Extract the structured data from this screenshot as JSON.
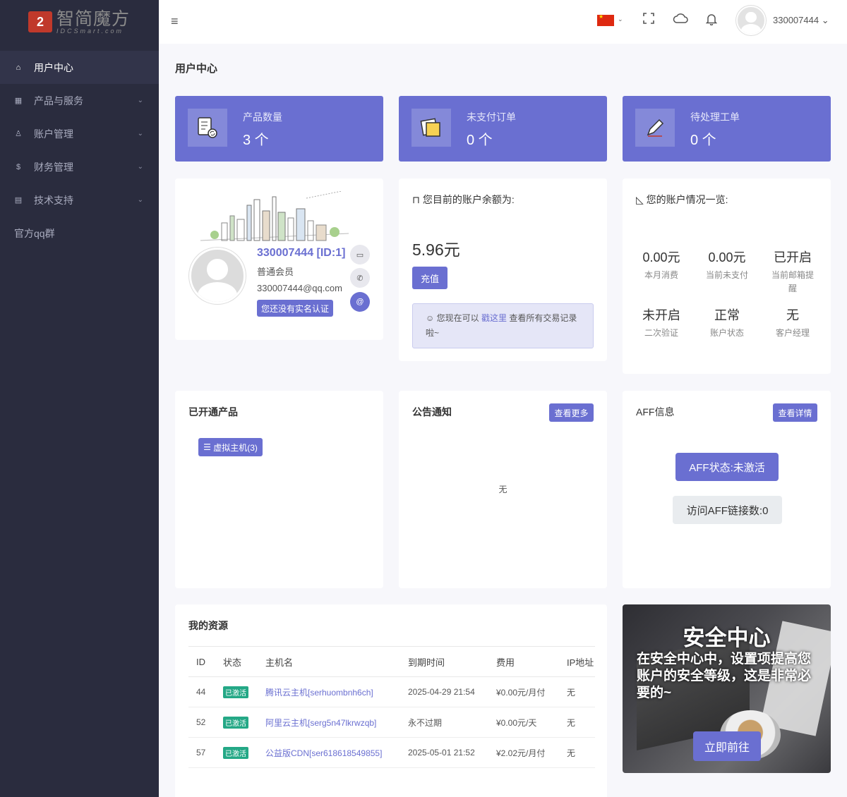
{
  "logo": {
    "cn": "智简魔方",
    "en": "IDCSmart.com"
  },
  "sidebar": {
    "items": [
      {
        "label": "用户中心",
        "icon": "home-icon"
      },
      {
        "label": "产品与服务",
        "icon": "grid-icon"
      },
      {
        "label": "账户管理",
        "icon": "user-icon"
      },
      {
        "label": "财务管理",
        "icon": "dollar-icon"
      },
      {
        "label": "技术支持",
        "icon": "support-icon"
      }
    ],
    "qq_group": "官方qq群"
  },
  "header": {
    "username": "330007444"
  },
  "page_title": "用户中心",
  "stats": [
    {
      "label": "产品数量",
      "value": "3 个"
    },
    {
      "label": "未支付订单",
      "value": "0 个"
    },
    {
      "label": "待处理工单",
      "value": "0 个"
    }
  ],
  "profile": {
    "name": "330007444 [ID:1]",
    "level": "普通会员",
    "email": "330007444@qq.com",
    "verify_button": "您还没有实名认证"
  },
  "balance": {
    "title": "您目前的账户余额为:",
    "value": "5.96元",
    "recharge_button": "充值",
    "note_prefix": "您现在可以",
    "note_link": "戳这里",
    "note_suffix": "查看所有交易记录啦~"
  },
  "overview": {
    "title": "您的账户情况一览:",
    "items": [
      {
        "value": "0.00元",
        "label": "本月消费"
      },
      {
        "value": "0.00元",
        "label": "当前未支付"
      },
      {
        "value": "已开启",
        "label": "当前邮箱提醒"
      },
      {
        "value": "未开启",
        "label": "二次验证"
      },
      {
        "value": "正常",
        "label": "账户状态"
      },
      {
        "value": "无",
        "label": "客户经理"
      }
    ]
  },
  "products": {
    "title": "已开通产品",
    "vhost_button": "虚拟主机(3)"
  },
  "notice": {
    "title": "公告通知",
    "more_button": "查看更多",
    "empty": "无"
  },
  "aff": {
    "title": "AFF信息",
    "detail_button": "查看详情",
    "state": "AFF状态:未激活",
    "visits": "访问AFF链接数:0"
  },
  "resources": {
    "title": "我的资源",
    "columns": [
      "ID",
      "状态",
      "主机名",
      "到期时间",
      "费用",
      "IP地址"
    ],
    "rows": [
      {
        "id": "44",
        "status": "已激活",
        "host": "腾讯云主机[serhuombnh6ch]",
        "expire": "2025-04-29 21:54",
        "fee": "¥0.00元/月付",
        "ip": "无"
      },
      {
        "id": "52",
        "status": "已激活",
        "host": "阿里云主机[serg5n47lkrwzqb]",
        "expire": "永不过期",
        "fee": "¥0.00元/天",
        "ip": "无"
      },
      {
        "id": "57",
        "status": "已激活",
        "host": "公益版CDN[ser618618549855]",
        "expire": "2025-05-01 21:52",
        "fee": "¥2.02元/月付",
        "ip": "无"
      }
    ]
  },
  "security": {
    "title": "安全中心",
    "desc": "在安全中心中，设置项提高您账户的安全等级，这是非常必要的~",
    "button": "立即前往"
  },
  "colors": {
    "accent": "#6a6fd1",
    "sidebar": "#2a2c3e",
    "badge": "#24a886"
  }
}
